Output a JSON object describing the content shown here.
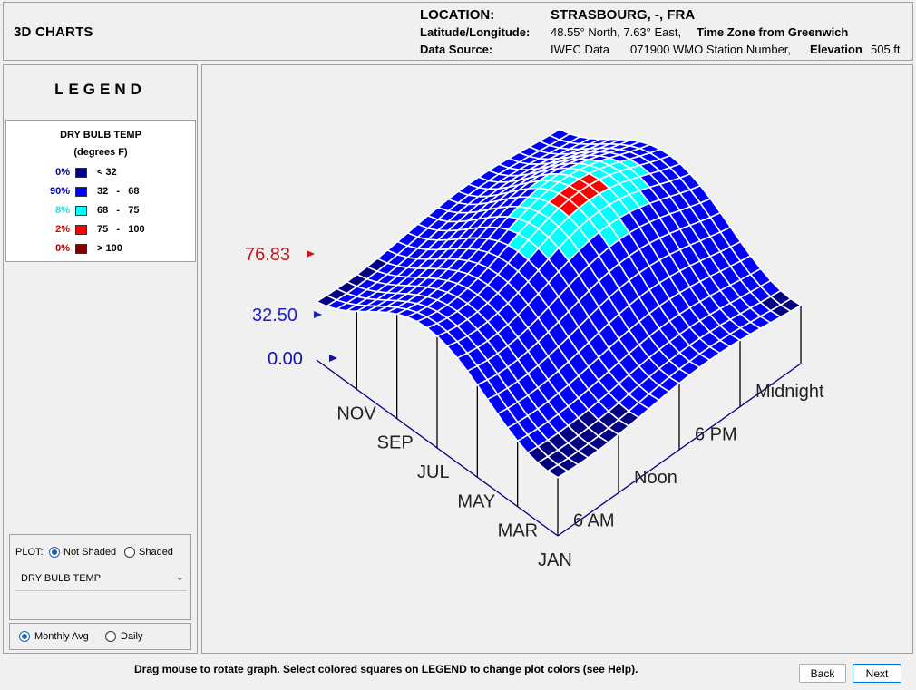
{
  "header": {
    "app_title": "3D CHARTS",
    "location_label": "LOCATION:",
    "location_value": "STRASBOURG, -, FRA",
    "latlon_label": "Latitude/Longitude:",
    "latlon_value": "48.55° North, 7.63° East,",
    "timezone_label": "Time Zone from Greenwich",
    "source_label": "Data Source:",
    "source_value": "IWEC Data",
    "station_value": "071900 WMO Station Number,",
    "elevation_label": "Elevation",
    "elevation_value": "505 ft"
  },
  "legend": {
    "title": "LEGEND",
    "variable": "DRY BULB TEMP",
    "unit": "(degrees F)",
    "rows": [
      {
        "pct": "0%",
        "range": "< 32",
        "color": "#000080",
        "pct_color": "#000080"
      },
      {
        "pct": "90%",
        "range": "32   -   68",
        "color": "#0000ff",
        "pct_color": "#0000c0"
      },
      {
        "pct": "8%",
        "range": "68   -   75",
        "color": "#00ffff",
        "pct_color": "#30d8d8"
      },
      {
        "pct": "2%",
        "range": "75   -   100",
        "color": "#ff0000",
        "pct_color": "#e00000"
      },
      {
        "pct": "0%",
        "range": "> 100",
        "color": "#800000",
        "pct_color": "#a00000"
      }
    ]
  },
  "plot_controls": {
    "plot_label": "PLOT:",
    "not_shaded_label": "Not Shaded",
    "shaded_label": "Shaded",
    "selected_mode": "Not Shaded",
    "variable_select": "DRY BULB TEMP",
    "monthly_label": "Monthly Avg",
    "daily_label": "Daily",
    "selected_period": "Monthly Avg"
  },
  "chart_data": {
    "type": "surface3d",
    "variable": "DRY BULB TEMP",
    "z_tick_labels": [
      "0.00",
      "32.50",
      "76.83"
    ],
    "z_ticks": [
      0.0,
      32.5,
      76.83
    ],
    "month_labels": [
      "JAN",
      "MAR",
      "MAY",
      "JUL",
      "SEP",
      "NOV"
    ],
    "hour_labels": [
      "6 AM",
      "Noon",
      "6 PM",
      "Midnight"
    ],
    "color_bands": [
      {
        "max": 32,
        "color": "#000080"
      },
      {
        "max": 68,
        "color": "#0000ff"
      },
      {
        "max": 75,
        "color": "#00ffff"
      },
      {
        "max": 100,
        "color": "#ff0000"
      },
      {
        "max": 999,
        "color": "#800000"
      }
    ],
    "axis_color": "#000080",
    "label_colors": {
      "low": "#1010b0",
      "mid": "#2020c0",
      "max": "#c01818"
    }
  },
  "footer": {
    "message": "Drag mouse to rotate graph.  Select colored squares on LEGEND to change plot colors (see Help).",
    "back_label": "Back",
    "next_label": "Next"
  }
}
